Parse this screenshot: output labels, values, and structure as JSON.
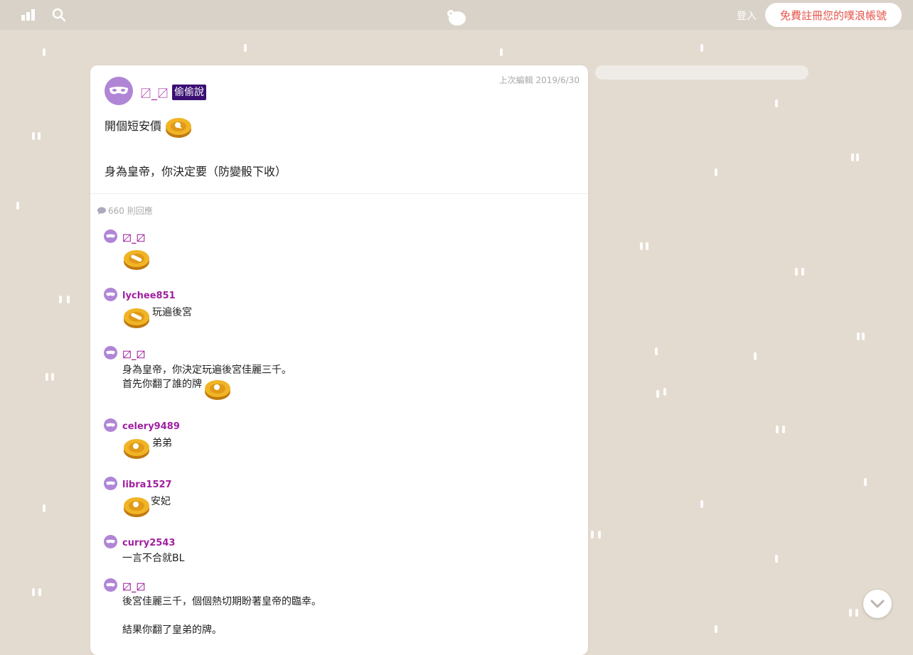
{
  "topbar": {
    "login_label": "登入",
    "signup_label": "免費註冊您的噗浪帳號",
    "left_icon": "bar-chart-icon",
    "search_icon": "search-icon",
    "logo_icon": "plurk-logo-icon",
    "accent": "#e5544b"
  },
  "post": {
    "edited_label": "上次編輯 2019/6/30",
    "author": "〼_〼",
    "badge": "偷偷說",
    "line1": "開個短安價",
    "line2": "身為皇帝，你決定要（防變骰下收）",
    "reply_count": "660 則回應"
  },
  "replies": [
    {
      "name": "〼_〼",
      "lines": []
    },
    {
      "name": "lychee851",
      "lines": [
        "玩遍後宮"
      ]
    },
    {
      "name": "〼_〼",
      "lines": [
        "身為皇帝，你決定玩遍後宮佳麗三千。",
        "首先你翻了誰的牌"
      ]
    },
    {
      "name": "celery9489",
      "lines": [
        "弟弟"
      ]
    },
    {
      "name": "libra1527",
      "lines": [
        "安妃"
      ]
    },
    {
      "name": "curry2543",
      "lines": [
        "一言不合就BL"
      ]
    },
    {
      "name": "〼_〼",
      "lines": [
        "後宮佳麗三千，個個熱切期盼著皇帝的臨幸。",
        "",
        "結果你翻了皇弟的牌。"
      ]
    }
  ],
  "colors": {
    "background": "#e4dbd0",
    "name": "#a020a0",
    "badge": "#3b0f73",
    "avatar": "#b085d6",
    "coin": "#e0a21a"
  }
}
